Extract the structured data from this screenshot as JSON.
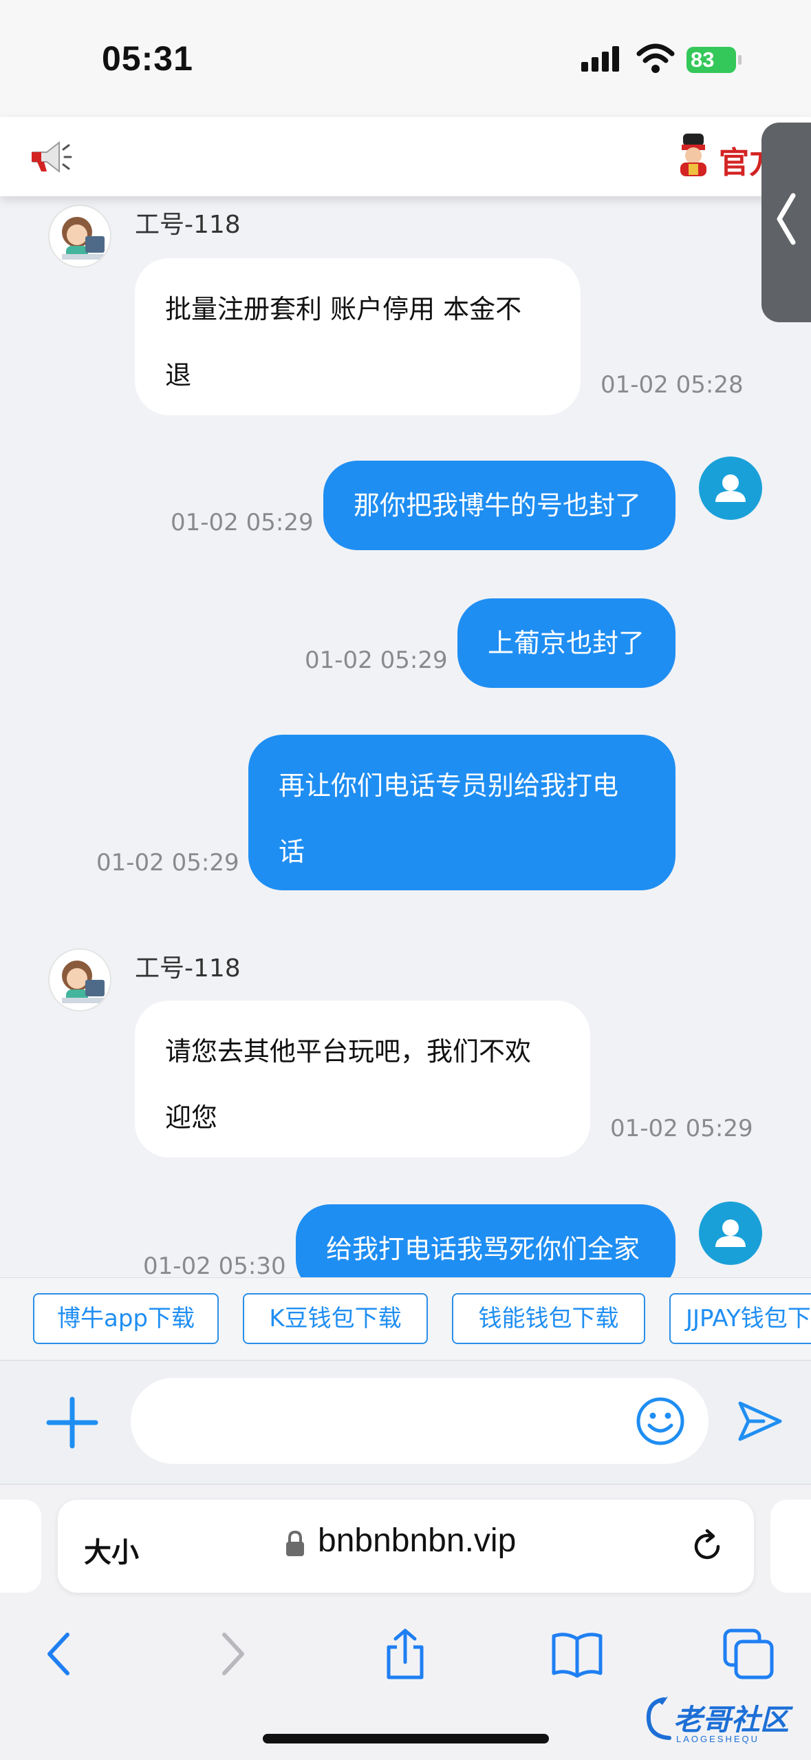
{
  "status_bar": {
    "time": "05:31",
    "battery": "83"
  },
  "header": {
    "official_label": "官方"
  },
  "messages": [
    {
      "sender": "agent",
      "name": "工号-118",
      "text": "批量注册套利 账户停用 本金不退",
      "time": "01-02 05:28"
    },
    {
      "sender": "user",
      "text": "那你把我博牛的号也封了",
      "time": "01-02 05:29"
    },
    {
      "sender": "user",
      "text": "上葡京也封了",
      "time": "01-02 05:29"
    },
    {
      "sender": "user",
      "text": "再让你们电话专员别给我打电话",
      "time": "01-02 05:29"
    },
    {
      "sender": "agent",
      "name": "工号-118",
      "text": "请您去其他平台玩吧，我们不欢迎您",
      "time": "01-02 05:29"
    },
    {
      "sender": "user",
      "text": "给我打电话我骂死你们全家",
      "time": "01-02 05:30"
    }
  ],
  "bubble_lines": {
    "m0": [
      "批量注册套利 账户停用 本金不",
      "退"
    ],
    "m3": [
      "再让你们电话专员别给我打电",
      "话"
    ],
    "m4": [
      "请您去其他平台玩吧，我们不欢",
      "迎您"
    ]
  },
  "quick_links": [
    "博牛app下载",
    "K豆钱包下载",
    "钱能钱包下载",
    "JJPAY钱包下"
  ],
  "input": {
    "placeholder": ""
  },
  "browser": {
    "text_size_label": "大小",
    "url": "bnbnbnbn.vip"
  },
  "watermark": {
    "text": "老哥社区",
    "sub": "LAOGESHEQU"
  },
  "colors": {
    "accent": "#1f8ef2",
    "user_avatar": "#1aa0d8",
    "official_red": "#d32323",
    "battery": "#34c759"
  }
}
